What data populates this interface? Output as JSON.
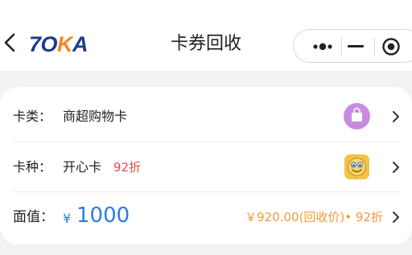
{
  "navbar": {
    "title": "卡券回收",
    "logo": {
      "part1": "7O",
      "part2": "K",
      "part3": "A"
    }
  },
  "card_form": {
    "card_category": {
      "label": "卡类：",
      "value": "商超购物卡",
      "icon": "shopping-bag-icon"
    },
    "card_type": {
      "label": "卡种：",
      "value": "开心卡",
      "discount": "92折",
      "icon": "smiley-icon"
    },
    "face_value": {
      "label": "面值：",
      "currency": "¥",
      "amount": "1000",
      "recycle_info": "￥920.00(回收价)• 92折"
    }
  },
  "colors": {
    "accent_blue": "#2a7de1",
    "discount_red": "#e8484a",
    "recycle_orange": "#f39a3c",
    "logo_blue": "#1d3b8f",
    "logo_orange": "#f08a24"
  }
}
